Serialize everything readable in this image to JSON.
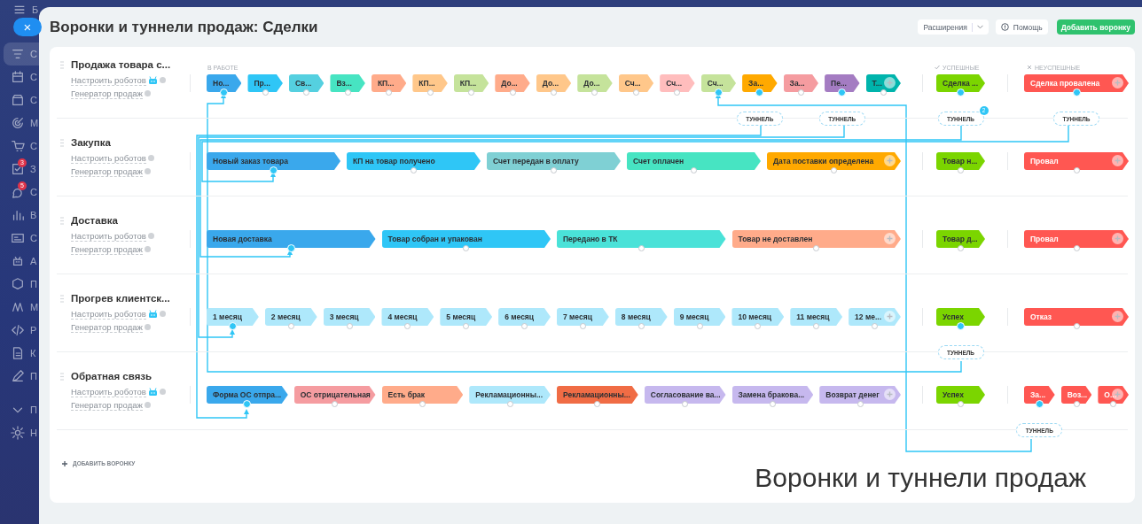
{
  "sidebar": {
    "header": "Б",
    "items": [
      {
        "label": "С",
        "selected": true
      },
      {
        "label": "С",
        "selected": false
      },
      {
        "label": "С",
        "selected": false
      },
      {
        "label": "М",
        "selected": false
      },
      {
        "label": "С",
        "selected": false
      },
      {
        "label": "З",
        "selected": false,
        "badge": "3"
      },
      {
        "label": "С",
        "selected": false,
        "badge": "5"
      },
      {
        "label": "В",
        "selected": false
      },
      {
        "label": "С",
        "selected": false
      },
      {
        "label": "А",
        "selected": false
      },
      {
        "label": "П",
        "selected": false
      },
      {
        "label": "М",
        "selected": false
      },
      {
        "label": "Р",
        "selected": false
      },
      {
        "label": "К",
        "selected": false
      },
      {
        "label": "П",
        "selected": false
      },
      {
        "label": "П",
        "selected": false
      },
      {
        "label": "Н",
        "selected": false
      }
    ]
  },
  "close_button": "×",
  "header": {
    "title": "Воронки и туннели продаж: Сделки",
    "buttons": [
      {
        "kind": "dropdown",
        "label": "Расширения"
      },
      {
        "kind": "help",
        "label": "Помощь"
      },
      {
        "kind": "primary",
        "label": "Добавить воронку"
      }
    ]
  },
  "group_captions": {
    "work": "В РАБОТЕ",
    "success": "УСПЕШНЫЕ",
    "fail": "НЕУСПЕШНЫЕ"
  },
  "funnels": [
    {
      "name": "Продажа товара с...",
      "links": [
        "Настроить роботов",
        "Генератор продаж"
      ],
      "robots_active": true,
      "work": [
        {
          "name": "Но...",
          "color": "#3aa8ec",
          "linked": true
        },
        {
          "name": "Пр...",
          "color": "#2fc6f6",
          "linked": false
        },
        {
          "name": "Св...",
          "color": "#55d0e0",
          "linked": false
        },
        {
          "name": "Вз...",
          "color": "#47e4c2",
          "linked": false
        },
        {
          "name": "КП...",
          "color": "#ffab8a",
          "linked": false
        },
        {
          "name": "КП...",
          "color": "#ffc78a",
          "linked": false
        },
        {
          "name": "КП...",
          "color": "#c5e39b",
          "linked": false
        },
        {
          "name": "До...",
          "color": "#ffab8a",
          "linked": false
        },
        {
          "name": "До...",
          "color": "#ffc78a",
          "linked": false
        },
        {
          "name": "До...",
          "color": "#c5e39b",
          "linked": false
        },
        {
          "name": "Сч...",
          "color": "#ffc78a",
          "linked": false
        },
        {
          "name": "Сч...",
          "color": "#ffbdbd",
          "linked": false
        },
        {
          "name": "Сч...",
          "color": "#c5e39b",
          "linked": true
        },
        {
          "name": "За...",
          "color": "#ffa900",
          "linked": true,
          "tunnel": "ТУННЕЛЬ"
        },
        {
          "name": "За...",
          "color": "#f59ca0",
          "linked": false
        },
        {
          "name": "Пе...",
          "color": "#a47cc2",
          "linked": true,
          "tunnel": "ТУННЕЛЬ"
        },
        {
          "name": "Т...",
          "color": "#00b4ac",
          "linked": false
        }
      ],
      "success": [
        {
          "name": "Сделка ...",
          "color": "#7bd500",
          "linked": true,
          "tunnel": "ТУННЕЛЬ",
          "tunnel_badge": "2"
        }
      ],
      "fail": [
        {
          "name": "Сделка провалена",
          "color": "#ff5752",
          "linked": true,
          "tunnel": "ТУННЕЛЬ"
        }
      ]
    },
    {
      "name": "Закупка",
      "links": [
        "Настроить роботов",
        "Генератор продаж"
      ],
      "robots_active": false,
      "work": [
        {
          "name": "Новый заказ товара",
          "color": "#3aa8ec",
          "linked": true
        },
        {
          "name": "КП на товар получено",
          "color": "#2fc6f6",
          "linked": false
        },
        {
          "name": "Счет передан в оплату",
          "color": "#7fd0d4",
          "linked": false
        },
        {
          "name": "Счет оплачен",
          "color": "#47e4c2",
          "linked": false
        },
        {
          "name": "Дата поставки определена",
          "color": "#ffa900",
          "linked": false
        }
      ],
      "success": [
        {
          "name": "Товар н...",
          "color": "#7bd500",
          "linked": false
        }
      ],
      "fail": [
        {
          "name": "Провал",
          "color": "#ff5752",
          "linked": false
        }
      ]
    },
    {
      "name": "Доставка",
      "links": [
        "Настроить роботов",
        "Генератор продаж"
      ],
      "robots_active": false,
      "work": [
        {
          "name": "Новая доставка",
          "color": "#3aa8ec",
          "linked": true
        },
        {
          "name": "Товар собран и упакован",
          "color": "#2fc6f6",
          "linked": false
        },
        {
          "name": "Передано в ТК",
          "color": "#4ae2d8",
          "linked": false
        },
        {
          "name": "Товар не доставлен",
          "color": "#ffab8a",
          "linked": false
        }
      ],
      "success": [
        {
          "name": "Товар д...",
          "color": "#7bd500",
          "linked": false
        }
      ],
      "fail": [
        {
          "name": "Провал",
          "color": "#ff5752",
          "linked": false
        }
      ]
    },
    {
      "name": "Прогрев клиентск...",
      "links": [
        "Настроить роботов",
        "Генератор продаж"
      ],
      "robots_active": true,
      "work": [
        {
          "name": "1 месяц",
          "color": "#aee8fb",
          "linked": true
        },
        {
          "name": "2 месяц",
          "color": "#aee8fb",
          "linked": false
        },
        {
          "name": "3 месяц",
          "color": "#aee8fb",
          "linked": false
        },
        {
          "name": "4 месяц",
          "color": "#aee8fb",
          "linked": false
        },
        {
          "name": "5 месяц",
          "color": "#aee8fb",
          "linked": false
        },
        {
          "name": "6 месяц",
          "color": "#aee8fb",
          "linked": false
        },
        {
          "name": "7 месяц",
          "color": "#aee8fb",
          "linked": false
        },
        {
          "name": "8 месяц",
          "color": "#aee8fb",
          "linked": false
        },
        {
          "name": "9 месяц",
          "color": "#aee8fb",
          "linked": false
        },
        {
          "name": "10 месяц",
          "color": "#aee8fb",
          "linked": false
        },
        {
          "name": "11 месяц",
          "color": "#aee8fb",
          "linked": false
        },
        {
          "name": "12 ме...",
          "color": "#aee8fb",
          "linked": false
        }
      ],
      "success": [
        {
          "name": "Успех",
          "color": "#7bd500",
          "linked": true,
          "tunnel": "ТУННЕЛЬ"
        }
      ],
      "fail": [
        {
          "name": "Отказ",
          "color": "#ff5752",
          "linked": false
        }
      ]
    },
    {
      "name": "Обратная связь",
      "links": [
        "Настроить роботов",
        "Генератор продаж"
      ],
      "robots_active": true,
      "work": [
        {
          "name": "Форма ОС отпра...",
          "color": "#3aa8ec",
          "linked": true
        },
        {
          "name": "ОС отрицательная",
          "color": "#f59ca0",
          "linked": false
        },
        {
          "name": "Есть брак",
          "color": "#ffab8a",
          "linked": false
        },
        {
          "name": "Рекламационны...",
          "color": "#aee8fb",
          "linked": false
        },
        {
          "name": "Рекламационны...",
          "color": "#f06c45",
          "linked": false
        },
        {
          "name": "Согласование ва...",
          "color": "#c6b8ee",
          "linked": false
        },
        {
          "name": "Замена бракова...",
          "color": "#c6b8ee",
          "linked": false
        },
        {
          "name": "Возврат денег",
          "color": "#c6b8ee",
          "linked": false
        }
      ],
      "success": [
        {
          "name": "Успех",
          "color": "#7bd500",
          "linked": false
        }
      ],
      "fail": [
        {
          "name": "За...",
          "color": "#ff5752",
          "linked": true,
          "tunnel": "ТУННЕЛЬ"
        },
        {
          "name": "Воз...",
          "color": "#ff5752",
          "linked": false
        },
        {
          "name": "О...",
          "color": "#ff5752",
          "linked": false
        }
      ]
    }
  ],
  "add_funnel": "ДОБАВИТЬ ВОРОНКУ",
  "caption": "Воронки и туннели продаж"
}
